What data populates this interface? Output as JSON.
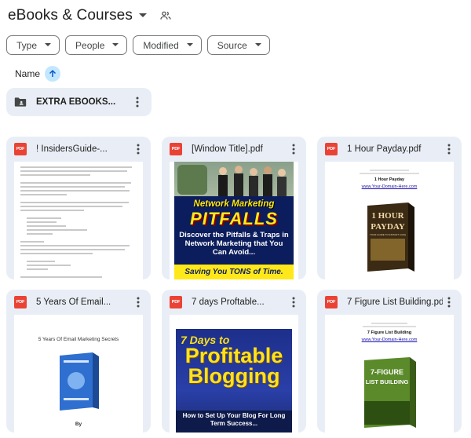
{
  "header": {
    "title": "eBooks & Courses",
    "caret_icon": "arrow-drop-down-icon",
    "shared_icon": "people-icon"
  },
  "filters": [
    {
      "label": "Type"
    },
    {
      "label": "People"
    },
    {
      "label": "Modified"
    },
    {
      "label": "Source"
    }
  ],
  "sort": {
    "label": "Name",
    "direction_icon": "arrow-upward-icon",
    "accent": "#c2e7ff"
  },
  "folder": {
    "name": "EXTRA EBOOKS..."
  },
  "files": [
    {
      "name": "! InsidersGuide-..."
    },
    {
      "name": "[Window Title].pdf"
    },
    {
      "name": "1 Hour Payday.pdf"
    },
    {
      "name": "5 Years Of Email..."
    },
    {
      "name": "7 days Proftable..."
    },
    {
      "name": "7 Figure List Building.pdf"
    }
  ],
  "thumbnails": {
    "network_marketing": {
      "title": "Network Marketing",
      "pitfalls": "PITFALLS",
      "subtitle": "Discover the Pitfalls & Traps in Network Marketing that You Can Avoid...",
      "bottom": "Saving You TONS of Time."
    },
    "payday": {
      "heading": "1 Hour Payday",
      "link": "www.Your-Domain-Here.com",
      "cover_line1": "1 HOUR",
      "cover_line2": "PAYDAY",
      "cover_sub": "YOUR GUIDE TO INSTANT CASH"
    },
    "email": {
      "title": "5 Years Of Email Marketing Secrets",
      "by": "By"
    },
    "blogging": {
      "line1": "7 Days to",
      "line2": "Profitable",
      "line3": "Blogging",
      "sub": "How to Set Up Your Blog For Long Term Success..."
    },
    "list_building": {
      "heading": "7 Figure List Building",
      "link": "www.Your-Domain-Here.com",
      "cover_line1": "7-FIGURE",
      "cover_line2": "LIST BUILDING"
    }
  },
  "colors": {
    "card_bg": "#e9eef6",
    "pdf_red": "#ea4335",
    "chip_border": "#747775"
  }
}
